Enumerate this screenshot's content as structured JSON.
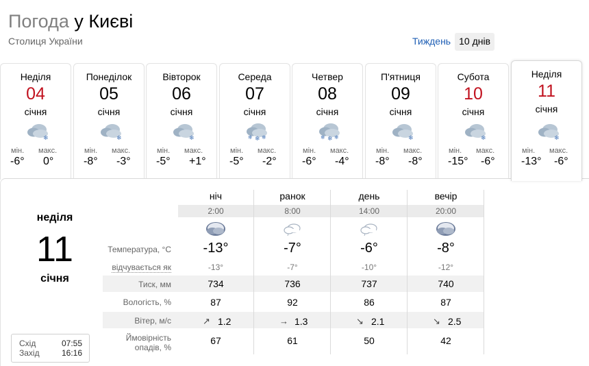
{
  "header": {
    "title_prefix": "Погода",
    "title_city": " у Києві",
    "subtitle": "Столиця України",
    "toggle": {
      "week": "Тиждень",
      "ten_days": "10 днів"
    }
  },
  "days": [
    {
      "name": "Неділя",
      "num": "04",
      "month": "січня",
      "weekend": true,
      "icon": "cloud-snow-icon",
      "min_label": "мін.",
      "max_label": "макс.",
      "min": "-6°",
      "max": "0°"
    },
    {
      "name": "Понеділок",
      "num": "05",
      "month": "січня",
      "weekend": false,
      "icon": "cloud-snow-icon",
      "min_label": "мін.",
      "max_label": "макс.",
      "min": "-8°",
      "max": "-3°"
    },
    {
      "name": "Вівторок",
      "num": "06",
      "month": "січня",
      "weekend": false,
      "icon": "cloud-snow-icon",
      "min_label": "мін.",
      "max_label": "макс.",
      "min": "-5°",
      "max": "+1°"
    },
    {
      "name": "Середа",
      "num": "07",
      "month": "січня",
      "weekend": false,
      "icon": "cloud-heavy-snow-icon",
      "min_label": "мін.",
      "max_label": "макс.",
      "min": "-5°",
      "max": "-2°"
    },
    {
      "name": "Четвер",
      "num": "08",
      "month": "січня",
      "weekend": false,
      "icon": "cloud-heavy-snow-icon",
      "min_label": "мін.",
      "max_label": "макс.",
      "min": "-6°",
      "max": "-4°"
    },
    {
      "name": "П'ятниця",
      "num": "09",
      "month": "січня",
      "weekend": false,
      "icon": "cloud-snow-icon",
      "min_label": "мін.",
      "max_label": "макс.",
      "min": "-8°",
      "max": "-8°"
    },
    {
      "name": "Субота",
      "num": "10",
      "month": "січня",
      "weekend": true,
      "icon": "cloud-snow-icon",
      "min_label": "мін.",
      "max_label": "макс.",
      "min": "-15°",
      "max": "-6°"
    },
    {
      "name": "Неділя",
      "num": "11",
      "month": "січня",
      "weekend": true,
      "icon": "cloud-snow-icon",
      "min_label": "мін.",
      "max_label": "макс.",
      "min": "-13°",
      "max": "-6°"
    }
  ],
  "selected": {
    "day_name": "неділя",
    "day_num": "11",
    "month": "січня",
    "sunrise_label": "Схід",
    "sunrise": "07:55",
    "sunset_label": "Захід",
    "sunset": "16:16"
  },
  "table": {
    "columns": [
      {
        "name": "ніч",
        "time": "2:00",
        "icon": "moon-cloud-icon",
        "temp": "-13°",
        "feels": "-13°",
        "pressure": "734",
        "humidity": "87",
        "wind_dir": "↗",
        "wind": "1.2",
        "precip": "67"
      },
      {
        "name": "ранок",
        "time": "8:00",
        "icon": "cloud-icon",
        "temp": "-7°",
        "feels": "-7°",
        "pressure": "736",
        "humidity": "92",
        "wind_dir": "→",
        "wind": "1.3",
        "precip": "61"
      },
      {
        "name": "день",
        "time": "14:00",
        "icon": "cloud-icon",
        "temp": "-6°",
        "feels": "-10°",
        "pressure": "737",
        "humidity": "86",
        "wind_dir": "↘",
        "wind": "2.1",
        "precip": "50"
      },
      {
        "name": "вечір",
        "time": "20:00",
        "icon": "moon-cloud-icon",
        "temp": "-8°",
        "feels": "-12°",
        "pressure": "740",
        "humidity": "87",
        "wind_dir": "↘",
        "wind": "2.5",
        "precip": "42"
      }
    ],
    "row_labels": {
      "temperature": "Температура, °C",
      "feels": "відчувається як",
      "pressure": "Тиск, мм",
      "humidity": "Вологість, %",
      "wind": "Вітер, м/с",
      "precip_1": "Ймовірність",
      "precip_2": "опадів, %"
    }
  },
  "colors": {
    "weekend": "#c1121f",
    "link": "#1f5fb5",
    "band": "#f1f1f1"
  }
}
